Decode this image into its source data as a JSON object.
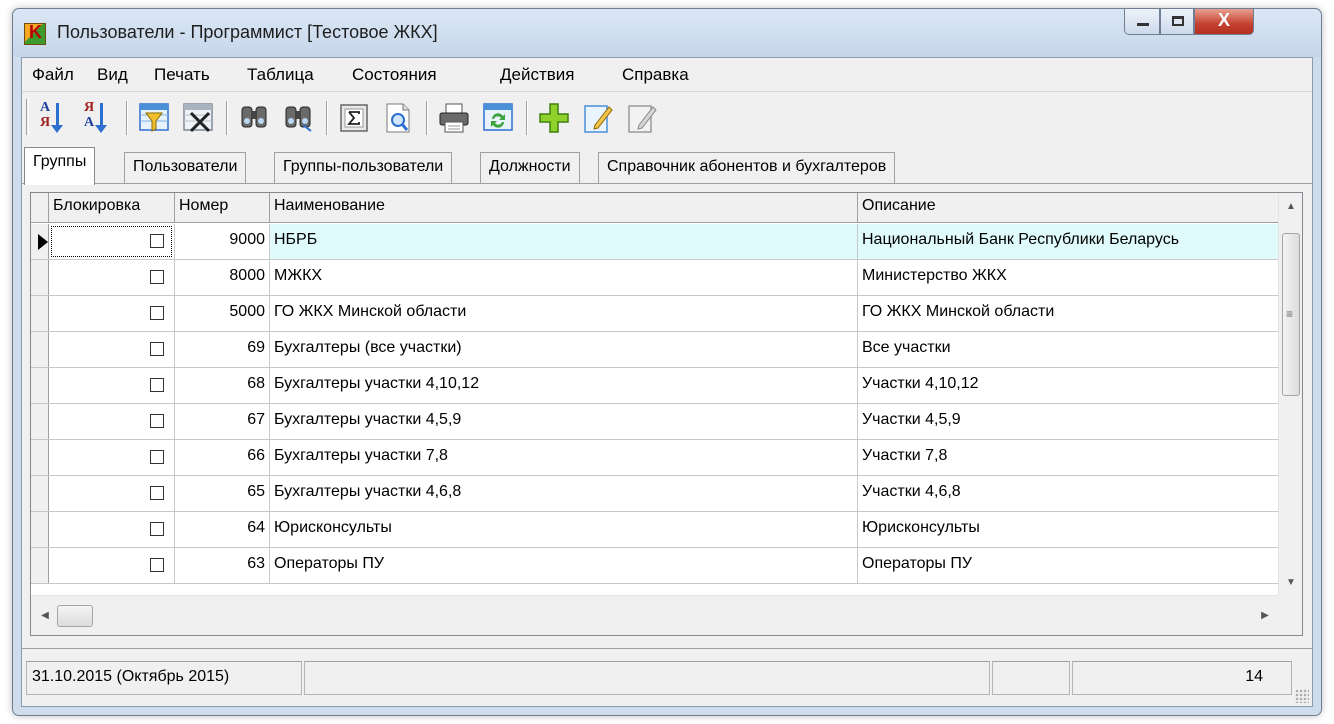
{
  "window": {
    "title": "Пользователи - Программист  [Тестовое ЖКХ]",
    "close_glyph": "X"
  },
  "menu": [
    "Файл",
    "Вид",
    "Печать",
    "Таблица",
    "Состояния",
    "Действия",
    "Справка"
  ],
  "toolbar": {
    "sort_az": {
      "top": "А",
      "bottom": "Я"
    },
    "sort_za": {
      "top": "Я",
      "bottom": "А"
    },
    "icons": [
      "sort-az-icon",
      "sort-za-icon",
      "filter-icon",
      "clear-filter-icon",
      "find-icon",
      "find-next-icon",
      "sum-icon",
      "preview-icon",
      "print-icon",
      "refresh-icon",
      "add-icon",
      "edit-icon",
      "edit-disabled-icon"
    ]
  },
  "tabs": [
    "Группы",
    "Пользователи",
    "Группы-пользователи",
    "Должности",
    "Справочник абонентов и бухгалтеров"
  ],
  "grid": {
    "columns": [
      "Блокировка",
      "Номер",
      "Наименование",
      "Описание"
    ],
    "rows": [
      {
        "num": "9000",
        "name": "НБРБ",
        "desc": "Национальный Банк Республики Беларусь",
        "blocked": false,
        "selected": true
      },
      {
        "num": "8000",
        "name": "МЖКХ",
        "desc": "Министерство ЖКХ",
        "blocked": false
      },
      {
        "num": "5000",
        "name": "ГО ЖКХ Минской области",
        "desc": "ГО ЖКХ Минской области",
        "blocked": false
      },
      {
        "num": "69",
        "name": "Бухгалтеры (все участки)",
        "desc": "Все участки",
        "blocked": false
      },
      {
        "num": "68",
        "name": "Бухгалтеры участки  4,10,12",
        "desc": "Участки  4,10,12",
        "blocked": false
      },
      {
        "num": "67",
        "name": "Бухгалтеры участки 4,5,9",
        "desc": "Участки 4,5,9",
        "blocked": false
      },
      {
        "num": "66",
        "name": "Бухгалтеры участки 7,8",
        "desc": "Участки 7,8",
        "blocked": false
      },
      {
        "num": "65",
        "name": "Бухгалтеры участки 4,6,8",
        "desc": "Участки 4,6,8",
        "blocked": false
      },
      {
        "num": "64",
        "name": "Юрисконсульты",
        "desc": "Юрисконсульты",
        "blocked": false
      },
      {
        "num": "63",
        "name": "Операторы ПУ",
        "desc": "Операторы ПУ",
        "blocked": false
      }
    ]
  },
  "status": {
    "date": "31.10.2015 (Октябрь 2015)",
    "count": "14"
  },
  "colors": {
    "selected_row": "#dffbfc",
    "close_button": "#c44030"
  }
}
